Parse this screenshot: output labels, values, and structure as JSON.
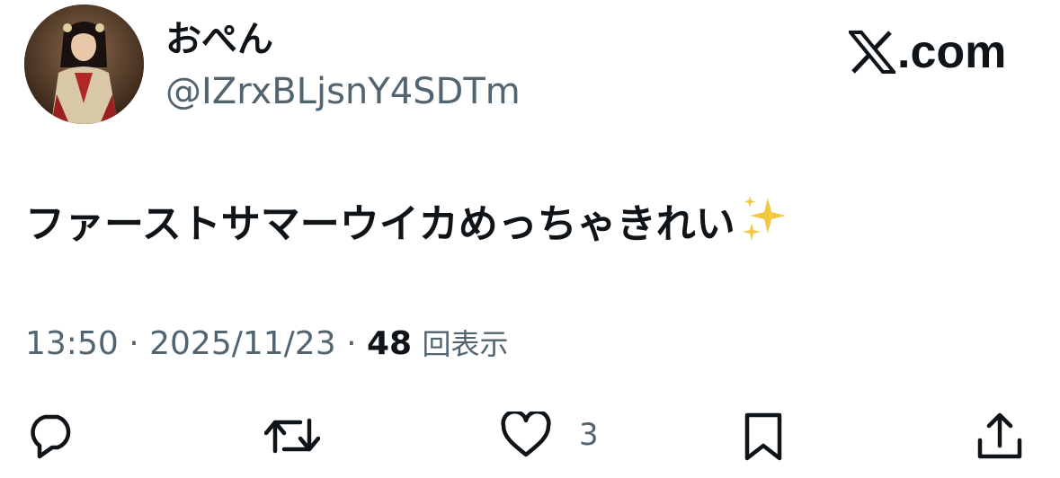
{
  "author": {
    "display_name": "おぺん",
    "handle": "@IZrxBLjsnY4SDTm"
  },
  "brand": {
    "text": ".com",
    "icon": "x-logo-icon"
  },
  "tweet": {
    "text": "ファーストサマーウイカめっちゃきれい",
    "emoji": "sparkles-icon"
  },
  "meta": {
    "time": "13:50",
    "separator": "·",
    "date": "2025/11/23",
    "views_count": "48",
    "views_label": "回表示"
  },
  "actions": {
    "reply": "reply-icon",
    "repost": "repost-icon",
    "like": "like-icon",
    "like_count": "3",
    "bookmark": "bookmark-icon",
    "share": "share-icon"
  },
  "colors": {
    "primary_text": "#0f1419",
    "secondary_text": "#536471",
    "sparkle": "#f5c842"
  }
}
